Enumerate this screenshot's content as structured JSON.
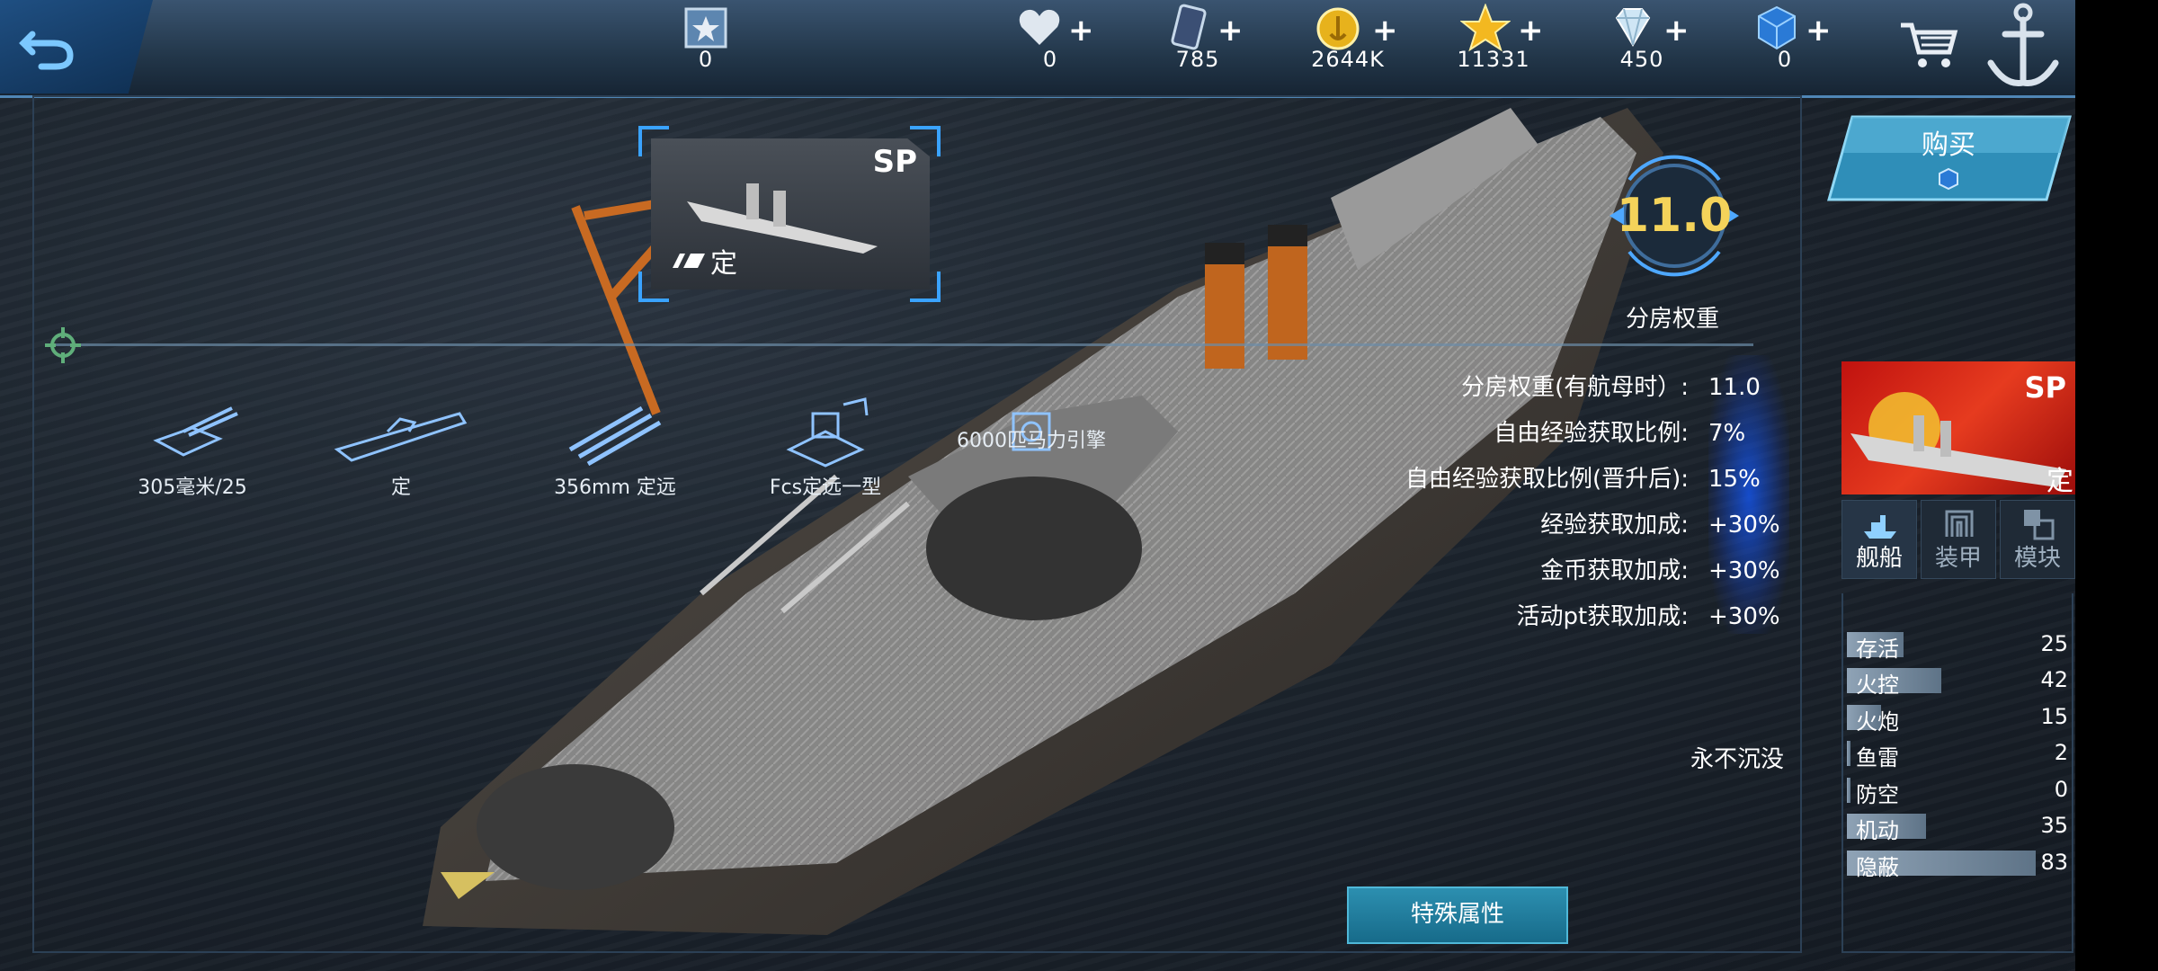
{
  "top_bar": {
    "resources": [
      {
        "icon": "rank-badge-icon",
        "value": "0",
        "has_plus": false
      },
      {
        "icon": "heart-icon",
        "value": "0",
        "has_plus": true
      },
      {
        "icon": "card-icon",
        "value": "785",
        "has_plus": true
      },
      {
        "icon": "gold-coin-icon",
        "value": "2644K",
        "has_plus": true
      },
      {
        "icon": "star-icon",
        "value": "11331",
        "has_plus": true
      },
      {
        "icon": "diamond-icon",
        "value": "450",
        "has_plus": true
      },
      {
        "icon": "blue-cube-icon",
        "value": "0",
        "has_plus": true
      }
    ],
    "plus": "+"
  },
  "card": {
    "rarity": "SP",
    "class": "定"
  },
  "equipment": [
    {
      "icon": "main-gun-icon",
      "label": "305毫米/25"
    },
    {
      "icon": "hull-icon",
      "label": "定"
    },
    {
      "icon": "torpedo-icon",
      "label": "356mm 定远"
    },
    {
      "icon": "fire-control-icon",
      "label": "Fcs定远一型"
    },
    {
      "icon": "engine-icon",
      "label": "6000匹马力引擎"
    }
  ],
  "weight": {
    "value": "11.0",
    "label": "分房权重"
  },
  "stats": [
    {
      "label": "分房权重(有航母时）:",
      "value": "11.0"
    },
    {
      "label": "自由经验获取比例:",
      "value": "7%"
    },
    {
      "label": "自由经验获取比例(晋升后):",
      "value": "15%"
    },
    {
      "label": "经验获取加成:",
      "value": "+30%"
    },
    {
      "label": "金币获取加成:",
      "value": "+30%"
    },
    {
      "label": "活动pt获取加成:",
      "value": "+30%"
    }
  ],
  "unsinkable": "永不沉没",
  "special_button": "特殊属性",
  "buy_button": "购买",
  "ship_thumb": {
    "rarity": "SP",
    "class": "定"
  },
  "tabs": [
    {
      "label": "舰船",
      "active": true
    },
    {
      "label": "装甲",
      "active": false
    },
    {
      "label": "模块",
      "active": false
    }
  ],
  "attributes": [
    {
      "name": "存活",
      "value": "25",
      "fill": 0.3
    },
    {
      "name": "火控",
      "value": "42",
      "fill": 0.5
    },
    {
      "name": "火炮",
      "value": "15",
      "fill": 0.18
    },
    {
      "name": "鱼雷",
      "value": "2",
      "fill": 0.02
    },
    {
      "name": "防空",
      "value": "0",
      "fill": 0.0
    },
    {
      "name": "机动",
      "value": "35",
      "fill": 0.42
    },
    {
      "name": "隐蔽",
      "value": "83",
      "fill": 1.0
    }
  ],
  "colors": {
    "accent": "#3aa3ff",
    "weight_number": "#f4d35a",
    "button": "#1f7fa0"
  }
}
